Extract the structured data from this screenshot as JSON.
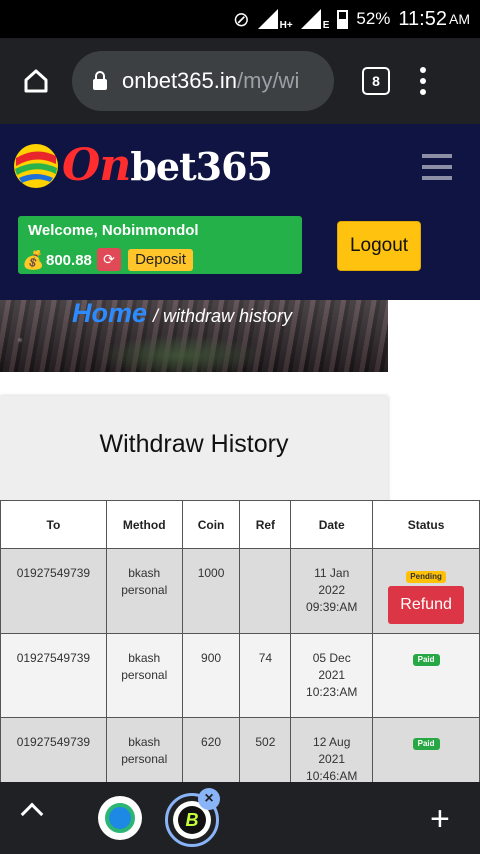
{
  "status_bar": {
    "network_type": "H+",
    "network_type_2": "E",
    "battery": "52%",
    "time": "11:52",
    "ampm": "AM"
  },
  "browser": {
    "url_host": "onbet365.in",
    "url_path": "/my/wi",
    "tab_count": "8"
  },
  "site": {
    "brand_first": "On",
    "brand_rest": "bet365",
    "welcome": "Welcome, Nobinmondol",
    "balance": "800.88",
    "deposit_label": "Deposit",
    "logout_label": "Logout"
  },
  "breadcrumb": {
    "home": "Home",
    "current": "/ withdraw history"
  },
  "page_title": "Withdraw History",
  "table": {
    "headers": [
      "To",
      "Method",
      "Coin",
      "Ref",
      "Date",
      "Status"
    ],
    "rows": [
      {
        "to": "01927549739",
        "method_1": "bkash",
        "method_2": "personal",
        "coin": "1000",
        "ref": "",
        "date_1": "11 Jan",
        "date_2": "2022",
        "date_3": "09:39:AM",
        "status": "Pending",
        "action": "Refund"
      },
      {
        "to": "01927549739",
        "method_1": "bkash",
        "method_2": "personal",
        "coin": "900",
        "ref": "74",
        "date_1": "05 Dec",
        "date_2": "2021",
        "date_3": "10:23:AM",
        "status": "Paid"
      },
      {
        "to": "01927549739",
        "method_1": "bkash",
        "method_2": "personal",
        "coin": "620",
        "ref": "502",
        "date_1": "12 Aug",
        "date_2": "2021",
        "date_3": "10:46:AM",
        "status": "Paid"
      }
    ]
  },
  "colors": {
    "header_bg": "#0f1442",
    "welcome_bg": "#25b14a",
    "logout_bg": "#ffc30f",
    "pending": "#ffc107",
    "paid": "#28a745",
    "refund": "#dc3545"
  }
}
